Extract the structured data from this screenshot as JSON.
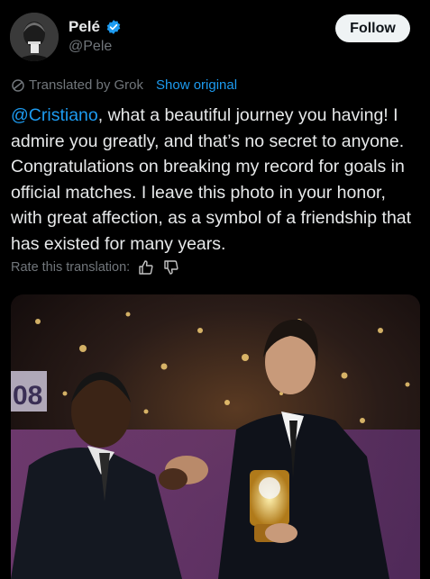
{
  "author": {
    "name": "Pelé",
    "handle": "@Pele",
    "verified": true
  },
  "follow_label": "Follow",
  "translation": {
    "label": "Translated by Grok",
    "show_original": "Show original"
  },
  "post": {
    "mention": "@Cristiano",
    "text": ", what a beautiful journey you having! I admire you greatly, and that’s no secret to anyone. Congratulations on breaking my record for goals in official matches. I leave this photo in your honor, with great affection, as a symbol of a friendship that has existed for many years."
  },
  "rate_label": "Rate this translation:",
  "photo_text": "08",
  "colors": {
    "accent": "#1d9bf0",
    "verified": "#1d9bf0",
    "muted": "#71767b",
    "background": "#000000"
  },
  "icons": [
    "verified-badge-icon",
    "translate-icon",
    "thumbs-up-icon",
    "thumbs-down-icon"
  ]
}
